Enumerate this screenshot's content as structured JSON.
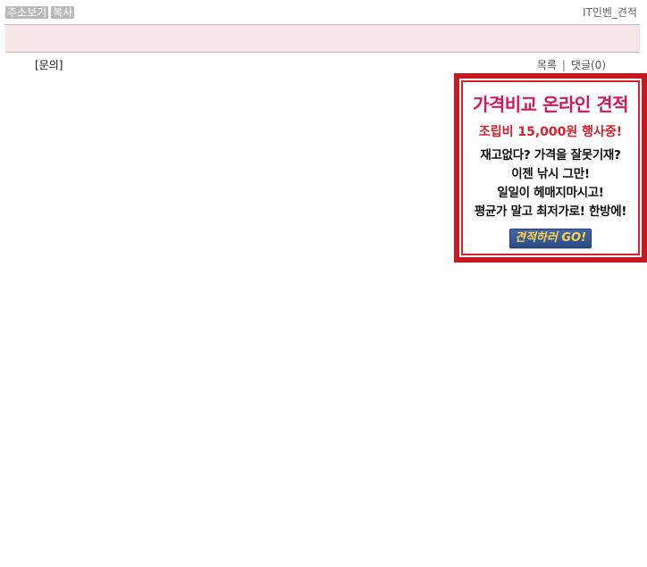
{
  "top": {
    "buttons": {
      "show_address": "주소보기",
      "copy": "복사"
    },
    "site_title": "IT인벤_견적"
  },
  "meta": {
    "category": "[문의]",
    "actions": {
      "list": "목록",
      "divider": "|",
      "comments_label": "댓글",
      "comments_count": "(0)"
    }
  },
  "ad": {
    "title": "가격비교 온라인 견적",
    "promo": "조립비 15,000원 행사중!",
    "lines": [
      "재고없다? 가격을 잘못기재?",
      "이젠 낚시 그만!",
      "일일이 헤매지마시고!",
      "평균가 말고 최저가로! 한방에!"
    ],
    "cta": "견적하러 GO!"
  },
  "colors": {
    "pill_bg": "#b9b9b9",
    "band_bg": "#f5e6e8",
    "ad_border": "#c61a22",
    "ad_title": "#d0185a",
    "ad_promo": "#d81f2a",
    "cta_bg": "#3c5d9e",
    "cta_text": "#ffd24a"
  }
}
